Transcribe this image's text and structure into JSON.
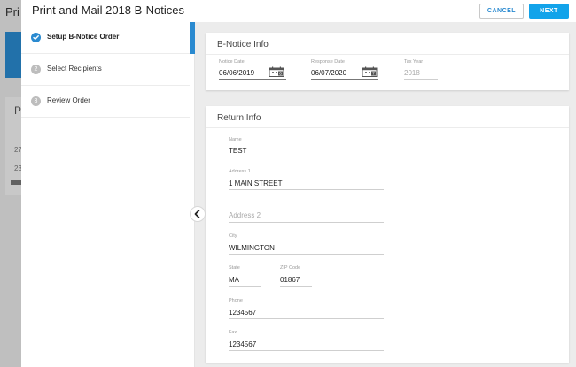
{
  "background": {
    "title": "Pri",
    "card_title": "P",
    "row1": "27",
    "row2": "23"
  },
  "header": {
    "title": "Print and Mail 2018 B-Notices",
    "cancel_label": "CANCEL",
    "next_label": "NEXT"
  },
  "steps": [
    {
      "label": "Setup B-Notice Order",
      "number": "",
      "state": "active"
    },
    {
      "label": "Select Recipients",
      "number": "2",
      "state": "pending"
    },
    {
      "label": "Review Order",
      "number": "3",
      "state": "pending"
    }
  ],
  "bnotice_info": {
    "title": "B-Notice Info",
    "notice_date": {
      "label": "Notice Date",
      "value": "06/06/2019"
    },
    "response_date": {
      "label": "Response Date",
      "value": "06/07/2020"
    },
    "tax_year": {
      "label": "Tax Year",
      "value": "2018"
    }
  },
  "return_info": {
    "title": "Return Info",
    "name": {
      "label": "Name",
      "value": "TEST"
    },
    "address1": {
      "label": "Address 1",
      "value": "1 MAIN STREET"
    },
    "address2": {
      "placeholder": "Address 2"
    },
    "city": {
      "label": "City",
      "value": "WILMINGTON"
    },
    "state": {
      "label": "State",
      "value": "MA"
    },
    "zip": {
      "label": "ZIP Code",
      "value": "01867"
    },
    "phone": {
      "label": "Phone",
      "value": "1234567"
    },
    "fax": {
      "label": "Fax",
      "value": "1234567"
    }
  },
  "icons": {
    "check": "check-circle-icon",
    "calendar": "calendar-icon",
    "collapse": "chevron-left-icon"
  },
  "colors": {
    "accent": "#2a8ad0",
    "primary_button": "#12a3ea"
  }
}
